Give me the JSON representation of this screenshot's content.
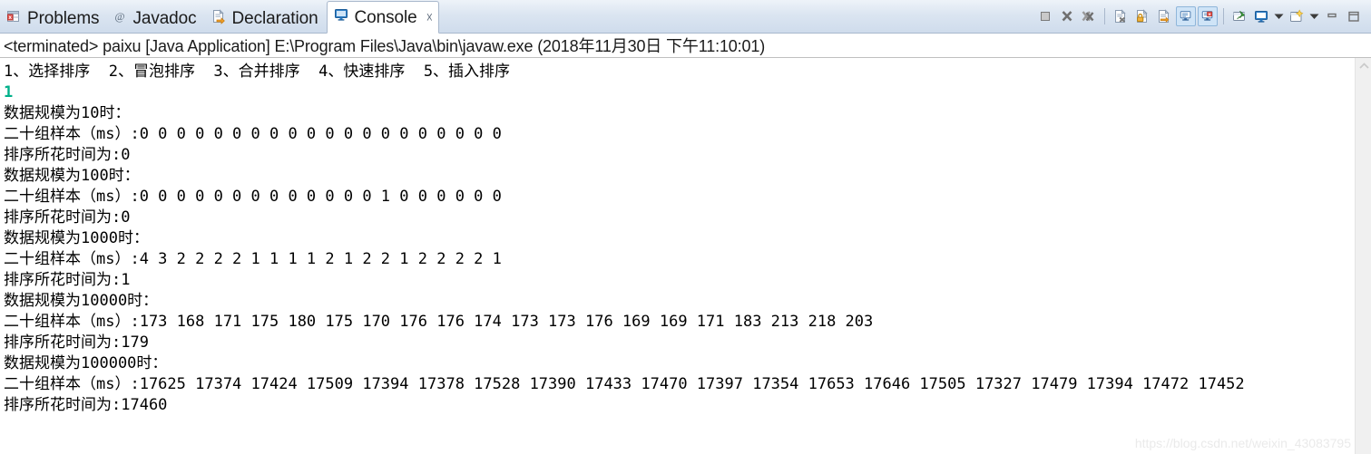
{
  "window": {
    "app": "Eclipse IDE",
    "active_view": "Console"
  },
  "tabs": [
    {
      "label": "Problems",
      "icon": "problems-icon",
      "active": false,
      "closable": false
    },
    {
      "label": "Javadoc",
      "icon": "javadoc-at-icon",
      "active": false,
      "closable": false
    },
    {
      "label": "Declaration",
      "icon": "declaration-icon",
      "active": false,
      "closable": false
    },
    {
      "label": "Console",
      "icon": "console-icon",
      "active": true,
      "closable": true,
      "close_glyph": "☓"
    }
  ],
  "toolbar": {
    "buttons": [
      {
        "name": "terminate-button",
        "icon": "stop-square-icon",
        "toggled": false
      },
      {
        "name": "remove-launch-button",
        "icon": "remove-x-icon",
        "toggled": false
      },
      {
        "name": "remove-all-launches-button",
        "icon": "remove-all-xx-icon",
        "toggled": false
      },
      {
        "name": "separator-1",
        "icon": "separator",
        "toggled": false
      },
      {
        "name": "clear-console-button",
        "icon": "clear-console-icon",
        "toggled": false
      },
      {
        "name": "scroll-lock-button",
        "icon": "lock-icon",
        "toggled": false
      },
      {
        "name": "word-wrap-button",
        "icon": "word-wrap-icon",
        "toggled": false
      },
      {
        "name": "show-console-on-output-button",
        "icon": "console-out-icon",
        "toggled": true
      },
      {
        "name": "show-console-on-error-button",
        "icon": "console-err-icon",
        "toggled": true
      },
      {
        "name": "separator-2",
        "icon": "separator",
        "toggled": false
      },
      {
        "name": "pin-console-button",
        "icon": "pin-console-icon",
        "toggled": false
      },
      {
        "name": "display-selected-console-button",
        "icon": "display-console-icon",
        "toggled": false
      },
      {
        "name": "display-console-dropdown",
        "icon": "chevron-down-icon",
        "toggled": false
      },
      {
        "name": "open-console-button",
        "icon": "new-console-icon",
        "toggled": false
      },
      {
        "name": "open-console-dropdown",
        "icon": "chevron-down-icon",
        "toggled": false
      },
      {
        "name": "minimize-view-button",
        "icon": "minimize-icon",
        "toggled": false
      },
      {
        "name": "maximize-view-button",
        "icon": "maximize-icon",
        "toggled": false
      }
    ]
  },
  "launch": {
    "status": "<terminated>",
    "config_name": "paixu",
    "type": "[Java Application]",
    "vm_path": "E:\\Program Files\\Java\\bin\\javaw.exe",
    "timestamp": "(2018年11月30日 下午11:10:01)",
    "full_text": "<terminated> paixu [Java Application] E:\\Program Files\\Java\\bin\\javaw.exe (2018年11月30日 下午11:10:01)"
  },
  "console": {
    "menu_line": "1、选择排序  2、冒泡排序  3、合并排序  4、快速排序  5、插入排序",
    "user_input": "1",
    "sample_label_prefix": "二十组样本（ms）:",
    "scale_label_prefix": "数据规模为",
    "scale_label_suffix": "时：",
    "time_label_prefix": "排序所花时间为:",
    "blocks": [
      {
        "scale_line": "数据规模为10时：",
        "samples_line": "二十组样本（ms）:0 0 0 0 0 0 0 0 0 0 0 0 0 0 0 0 0 0 0 0",
        "time_line": "排序所花时间为:0",
        "scale": 10,
        "samples": [
          0,
          0,
          0,
          0,
          0,
          0,
          0,
          0,
          0,
          0,
          0,
          0,
          0,
          0,
          0,
          0,
          0,
          0,
          0,
          0
        ],
        "elapsed_ms": 0
      },
      {
        "scale_line": "数据规模为100时：",
        "samples_line": "二十组样本（ms）:0 0 0 0 0 0 0 0 0 0 0 0 0 1 0 0 0 0 0 0",
        "time_line": "排序所花时间为:0",
        "scale": 100,
        "samples": [
          0,
          0,
          0,
          0,
          0,
          0,
          0,
          0,
          0,
          0,
          0,
          0,
          0,
          1,
          0,
          0,
          0,
          0,
          0,
          0
        ],
        "elapsed_ms": 0
      },
      {
        "scale_line": "数据规模为1000时：",
        "samples_line": "二十组样本（ms）:4 3 2 2 2 2 1 1 1 1 2 1 2 2 1 2 2 2 2 1",
        "time_line": "排序所花时间为:1",
        "scale": 1000,
        "samples": [
          4,
          3,
          2,
          2,
          2,
          2,
          1,
          1,
          1,
          1,
          2,
          1,
          2,
          2,
          1,
          2,
          2,
          2,
          2,
          1
        ],
        "elapsed_ms": 1
      },
      {
        "scale_line": "数据规模为10000时：",
        "samples_line": "二十组样本（ms）:173 168 171 175 180 175 170 176 176 174 173 173 176 169 169 171 183 213 218 203",
        "time_line": "排序所花时间为:179",
        "scale": 10000,
        "samples": [
          173,
          168,
          171,
          175,
          180,
          175,
          170,
          176,
          176,
          174,
          173,
          173,
          176,
          169,
          169,
          171,
          183,
          213,
          218,
          203
        ],
        "elapsed_ms": 179
      },
      {
        "scale_line": "数据规模为100000时：",
        "samples_line": "二十组样本（ms）:17625 17374 17424 17509 17394 17378 17528 17390 17433 17470 17397 17354 17653 17646 17505 17327 17479 17394 17472 17452",
        "time_line": "排序所花时间为:17460",
        "scale": 100000,
        "samples": [
          17625,
          17374,
          17424,
          17509,
          17394,
          17378,
          17528,
          17390,
          17433,
          17470,
          17397,
          17354,
          17653,
          17646,
          17505,
          17327,
          17479,
          17394,
          17472,
          17452
        ],
        "elapsed_ms": 17460
      }
    ]
  },
  "watermark": {
    "text": "https://blog.csdn.net/weixin_43083795"
  },
  "colors": {
    "input_echo": "#00b08a",
    "tabbar_bg": "#dbe5f1",
    "toggle_bg": "#cfe4f7",
    "text": "#000000"
  }
}
